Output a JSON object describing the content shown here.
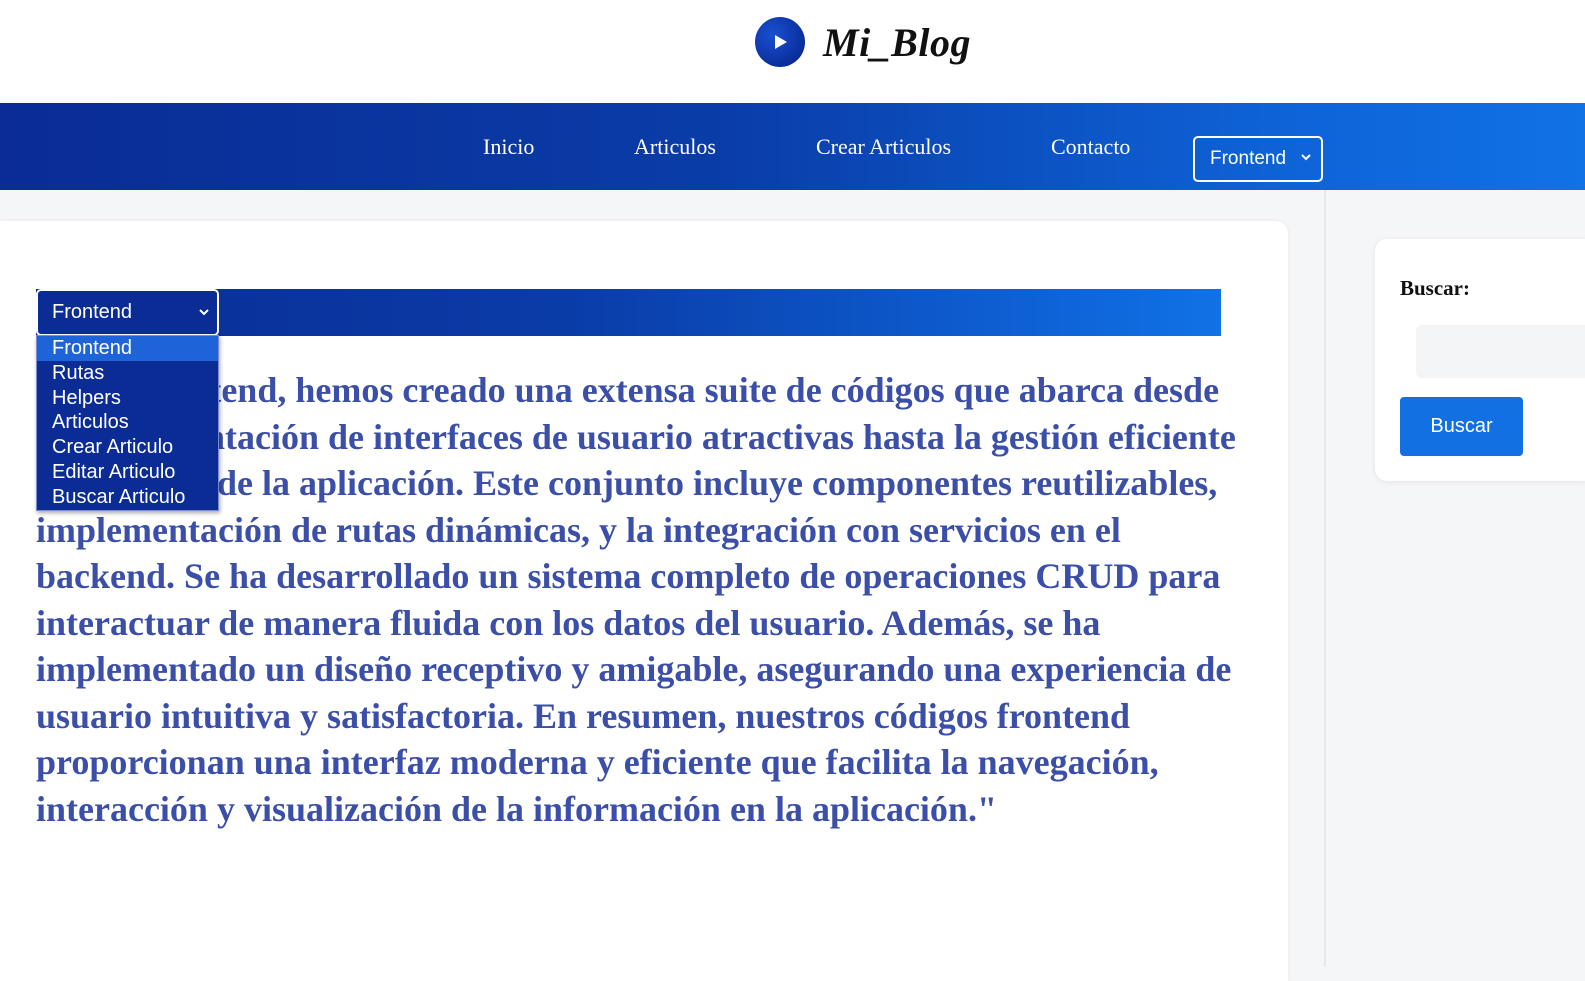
{
  "brand": {
    "title": "Mi_Blog"
  },
  "nav": {
    "links": [
      "Inicio",
      "Articulos",
      "Crear Articulos",
      "Contacto"
    ],
    "select_value": "Frontend"
  },
  "category_select": {
    "value": "Frontend",
    "options": [
      "Frontend",
      "Rutas",
      "Helpers",
      "Articulos",
      "Crear Articulo",
      "Editar Articulo",
      "Buscar Articulo"
    ],
    "selected_index": 0
  },
  "article": {
    "text": "\"En el frontend, hemos creado una extensa suite de códigos que abarca desde la implementación de interfaces de usuario atractivas hasta la gestión eficiente de la lógica de la aplicación. Este conjunto incluye componentes reutilizables, implementación de rutas dinámicas, y la integración con servicios en el backend. Se ha desarrollado un sistema completo de operaciones CRUD para interactuar de manera fluida con los datos del usuario. Además, se ha implementado un diseño receptivo y amigable, asegurando una experiencia de usuario intuitiva y satisfactoria. En resumen, nuestros códigos frontend proporcionan una interfaz moderna y eficiente que facilita la navegación, interacción y visualización de la información en la aplicación.\""
  },
  "sidebar": {
    "search_label": "Buscar:",
    "search_placeholder": "",
    "search_button": "Buscar"
  },
  "colors": {
    "accent": "#0a2c94",
    "accent_light": "#1072e6",
    "article_text": "#3b4fa8",
    "button": "#1270e3"
  },
  "icons": {
    "logo": "play-circle-icon",
    "select_arrow": "chevron-down-icon"
  }
}
